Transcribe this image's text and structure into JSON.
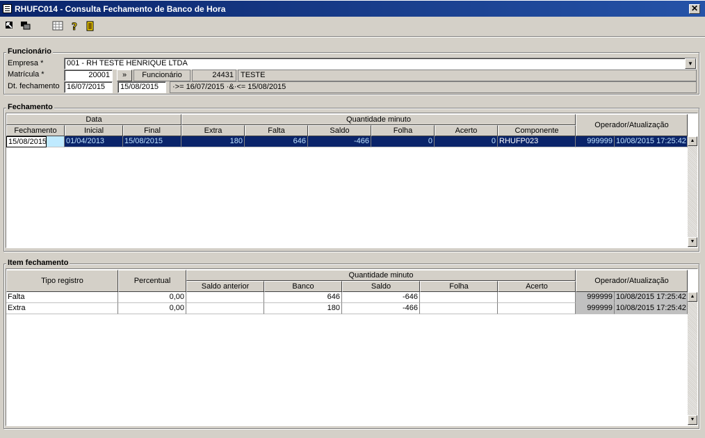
{
  "window": {
    "title": "RHUFC014 - Consulta Fechamento de Banco de Hora",
    "close": "✕"
  },
  "funcionario": {
    "title": "Funcionário",
    "empresa_label": "Empresa *",
    "empresa_value": "001 - RH TESTE HENRIQUE LTDA",
    "matricula_label": "Matrícula *",
    "matricula_value": "20001",
    "lookup_button": "»",
    "funcionario_label": "Funcionário",
    "funcionario_code": "24431",
    "funcionario_name": "TESTE",
    "dt_label": "Dt. fechamento",
    "dt_from": "16/07/2015",
    "dt_to": "15/08/2015",
    "dt_filter_text": "·>= 16/07/2015 ·&·<= 15/08/2015"
  },
  "fechamento": {
    "title": "Fechamento",
    "group_headers": {
      "data": "Data",
      "quantidade": "Quantidade minuto",
      "operador": "Operador/Atualização"
    },
    "columns": [
      "Fechamento",
      "Inicial",
      "Final",
      "Extra",
      "Falta",
      "Saldo",
      "Folha",
      "Acerto",
      "Componente"
    ],
    "rows": [
      {
        "fechamento": "15/08/2015",
        "inicial": "01/04/2013",
        "final": "15/08/2015",
        "extra": "180",
        "falta": "646",
        "saldo": "-466",
        "folha": "0",
        "acerto": "0",
        "componente": "RHUFP023",
        "operador": "999999",
        "atualizacao": "10/08/2015 17:25:42"
      }
    ]
  },
  "item": {
    "title": "Item fechamento",
    "headers": {
      "tipo": "Tipo registro",
      "percentual": "Percentual",
      "quantidade": "Quantidade minuto",
      "operador": "Operador/Atualização"
    },
    "columns": [
      "Saldo anterior",
      "Banco",
      "Saldo",
      "Folha",
      "Acerto"
    ],
    "rows": [
      {
        "tipo": "Falta",
        "percentual": "0,00",
        "saldo_anterior": "",
        "banco": "646",
        "saldo": "-646",
        "folha": "",
        "acerto": "",
        "operador": "999999",
        "atualizacao": "10/08/2015 17:25:42"
      },
      {
        "tipo": "Extra",
        "percentual": "0,00",
        "saldo_anterior": "",
        "banco": "180",
        "saldo": "-466",
        "folha": "",
        "acerto": "",
        "operador": "999999",
        "atualizacao": "10/08/2015 17:25:42"
      }
    ]
  },
  "icons": [
    "exit-icon",
    "copy-icon",
    "calculator-icon",
    "help-icon",
    "door-icon"
  ],
  "colors": {
    "titlebar": "#0a246a",
    "selection": "#0a246a",
    "face": "#d4d0c8"
  }
}
